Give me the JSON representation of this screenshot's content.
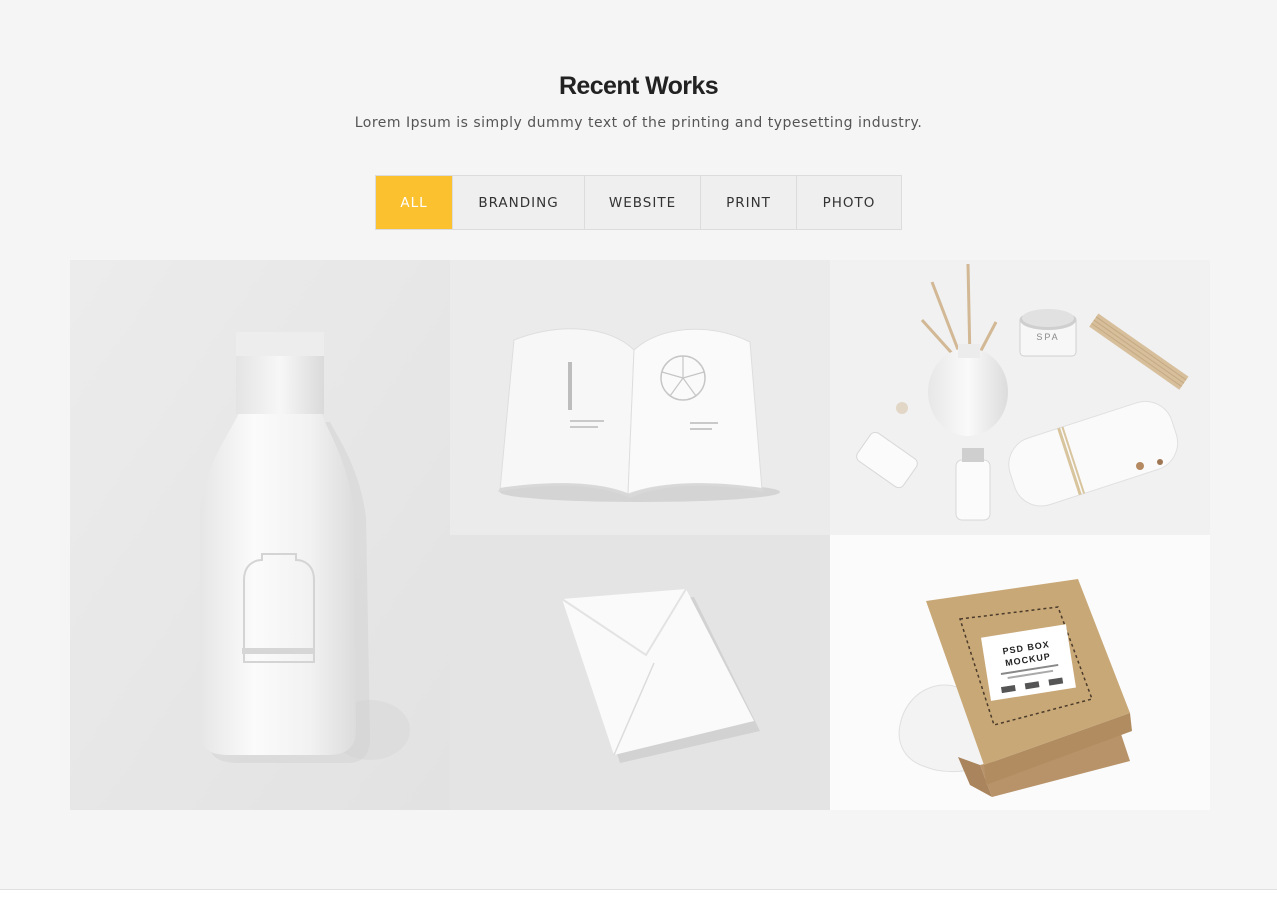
{
  "section": {
    "title": "Recent Works",
    "subtitle": "Lorem Ipsum is simply dummy text of the printing and typesetting industry."
  },
  "filters": [
    {
      "label": "ALL",
      "active": true
    },
    {
      "label": "BRANDING",
      "active": false
    },
    {
      "label": "WEBSITE",
      "active": false
    },
    {
      "label": "PRINT",
      "active": false
    },
    {
      "label": "PHOTO",
      "active": false
    }
  ],
  "portfolio": {
    "items": [
      {
        "name": "bottle-mockup",
        "jar_label": "",
        "box_title_line1": "",
        "box_title_line2": ""
      },
      {
        "name": "book-mockup"
      },
      {
        "name": "spa-mockup",
        "jar_label": "SPA"
      },
      {
        "name": "envelope-mockup"
      },
      {
        "name": "box-mockup",
        "box_title_line1": "PSD BOX",
        "box_title_line2": "MOCKUP"
      }
    ]
  },
  "colors": {
    "accent": "#fcc12f",
    "background": "#f5f5f5",
    "kraft": "#c9a877"
  }
}
